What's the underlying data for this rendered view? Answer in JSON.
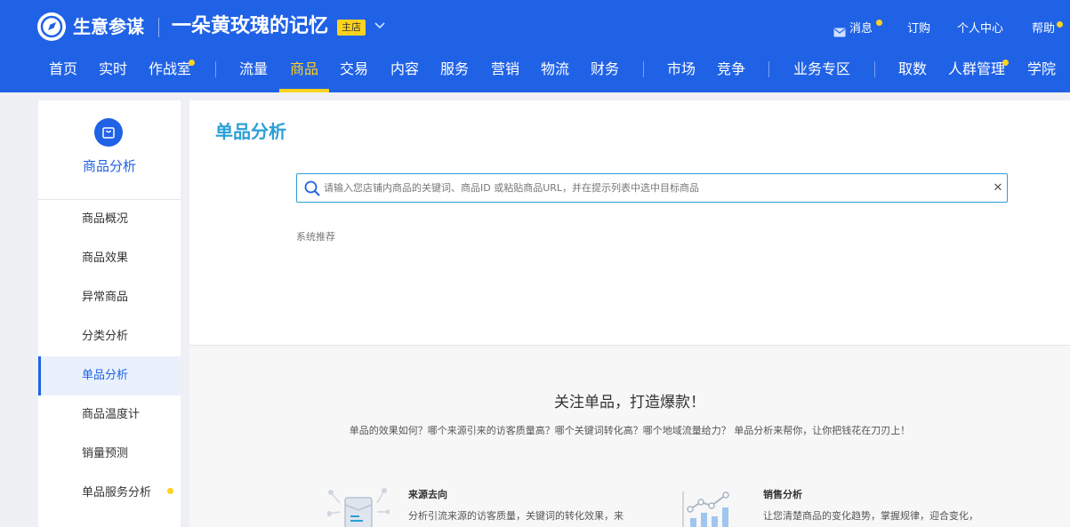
{
  "header": {
    "brand": "生意参谋",
    "shop_name": "一朵黄玫瑰的记忆",
    "shop_badge": "主店",
    "utils": {
      "messages": "消息",
      "subscribe": "订购",
      "personal_center": "个人中心",
      "help": "帮助"
    },
    "nav": {
      "home": "首页",
      "realtime": "实时",
      "war_room": "作战室",
      "traffic": "流量",
      "product": "商品",
      "trade": "交易",
      "content": "内容",
      "service": "服务",
      "marketing": "营销",
      "logistics": "物流",
      "finance": "财务",
      "market": "市场",
      "competition": "竞争",
      "business_zone": "业务专区",
      "data_fetch": "取数",
      "crowd_mgmt": "人群管理",
      "academy": "学院"
    },
    "active_nav": "商品"
  },
  "sidebar": {
    "title": "商品分析",
    "items": [
      {
        "label": "商品概况"
      },
      {
        "label": "商品效果"
      },
      {
        "label": "异常商品"
      },
      {
        "label": "分类分析"
      },
      {
        "label": "单品分析"
      },
      {
        "label": "商品温度计"
      },
      {
        "label": "销量预测"
      },
      {
        "label": "单品服务分析"
      }
    ],
    "active_item": "单品分析"
  },
  "main": {
    "title": "单品分析",
    "search": {
      "placeholder": "请输入您店铺内商品的关键词、商品ID 或粘贴商品URL，并在提示列表中选中目标商品",
      "value": ""
    },
    "system_recommend": "系统推荐",
    "promo": {
      "title": "关注单品，打造爆款！",
      "subtitle": "单品的效果如何？哪个来源引来的访客质量高？哪个关键词转化高？哪个地域流量给力？ 单品分析来帮你，让你把钱花在刀刃上！"
    },
    "features": [
      {
        "title": "来源去向",
        "desc": "分析引流来源的访客质量，关键词的转化效果，来"
      },
      {
        "title": "销售分析",
        "desc": "让您清楚商品的变化趋势，掌握规律，迎合变化，"
      }
    ]
  },
  "colors": {
    "header_bg": "#2062e6",
    "accent_yellow": "#ffd21e",
    "title_teal": "#2a9fd6",
    "active_blue": "#2062e6"
  }
}
